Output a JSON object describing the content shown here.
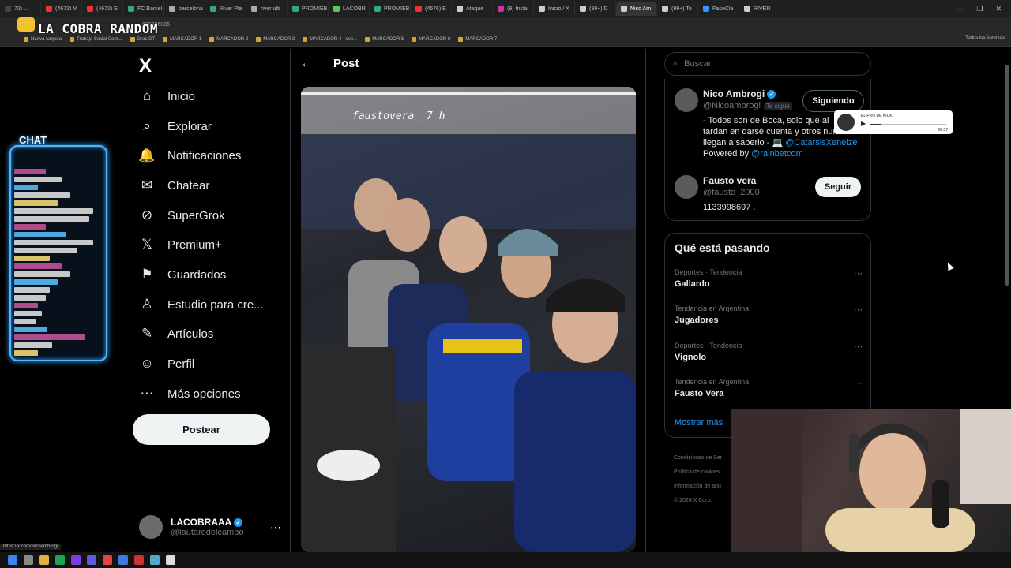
{
  "browser": {
    "tabs": [
      {
        "label": "72) ...",
        "color": "#444"
      },
      {
        "label": "(4672) M",
        "color": "#e33"
      },
      {
        "label": "(4672) E",
        "color": "#e33"
      },
      {
        "label": "FC Barcel",
        "color": "#3a7"
      },
      {
        "label": "barcelona",
        "color": "#aaa"
      },
      {
        "label": "River Pla",
        "color": "#3a7"
      },
      {
        "label": "river ulti",
        "color": "#aaa"
      },
      {
        "label": "PROMIEB",
        "color": "#3a7"
      },
      {
        "label": "LACOBR",
        "color": "#5c5"
      },
      {
        "label": "PROMIEB",
        "color": "#3a7"
      },
      {
        "label": "(4676) E",
        "color": "#e33"
      },
      {
        "label": "Ataque",
        "color": "#ccc"
      },
      {
        "label": "(9) Insta",
        "color": "#c3a"
      },
      {
        "label": "Inicio / X",
        "color": "#ccc"
      },
      {
        "label": "(99+) D",
        "color": "#ccc"
      },
      {
        "label": "Nico Am",
        "color": "#ccc"
      },
      {
        "label": "(99+) To",
        "color": "#ccc"
      },
      {
        "label": "PaseCla",
        "color": "#39f"
      },
      {
        "label": "RIVER",
        "color": "#ccc"
      }
    ],
    "active_tab": 15,
    "window_controls": [
      "—",
      "❐",
      "✕"
    ],
    "address_text": "600396085",
    "bookmarks": [
      "Nueva carpeta",
      "Trabajo Social Com...",
      "Gras DT",
      "MARCADOR 1",
      "MARCADOR 2",
      "MARCADOR 3",
      "MARCADOR 4 - ove...",
      "MARCADOR 5",
      "MARCADOR 6",
      "MARCADOR 7"
    ],
    "bookmarks_right": "Todos los favoritos",
    "status_url": "https://x.com/Nicoambrogi"
  },
  "overlay": {
    "logo_text": "LA COBRA RANDOM",
    "chat_title": "CHAT",
    "kick_title": "EL PRO DE KICK",
    "kick_time": "00:37",
    "kick_progress": 0.15
  },
  "nav": {
    "logo": "X",
    "items": [
      {
        "label": "Inicio",
        "icon": "home-icon",
        "glyph": "⌂"
      },
      {
        "label": "Explorar",
        "icon": "search-icon",
        "glyph": "⌕"
      },
      {
        "label": "Notificaciones",
        "icon": "bell-icon",
        "glyph": "🔔"
      },
      {
        "label": "Chatear",
        "icon": "mail-icon",
        "glyph": "✉"
      },
      {
        "label": "SuperGrok",
        "icon": "grok-icon",
        "glyph": "⊘"
      },
      {
        "label": "Premium+",
        "icon": "x-icon",
        "glyph": "𝕏"
      },
      {
        "label": "Guardados",
        "icon": "bookmark-icon",
        "glyph": "⚑"
      },
      {
        "label": "Estudio para cre...",
        "icon": "studio-icon",
        "glyph": "♙"
      },
      {
        "label": "Artículos",
        "icon": "article-icon",
        "glyph": "✎"
      },
      {
        "label": "Perfil",
        "icon": "person-icon",
        "glyph": "☺"
      },
      {
        "label": "Más opciones",
        "icon": "more-circle-icon",
        "glyph": "⋯"
      }
    ],
    "post_label": "Postear",
    "account": {
      "name": "LACOBRAAA",
      "handle": "@lautarodelcampo"
    }
  },
  "post": {
    "title": "Post",
    "photo_caption": "faustovera_  7 h"
  },
  "right": {
    "search_placeholder": "Buscar",
    "people": [
      {
        "name": "Nico Ambrogi",
        "handle": "@Nicoambrogi",
        "follows_you": "Te sigue",
        "button": "Siguiendo",
        "bio_1": "- Todos son de Boca, solo que al",
        "bio_2": "tardan en darse cuenta y otros nunca",
        "bio_3": "llegan a saberlo - 💻 ",
        "bio_link": "@CatarsisXeneize",
        "bio_4": "Powered by ",
        "bio_link2": "@rainbetcom"
      },
      {
        "name": "Fausto vera",
        "handle": "@fausto_2000",
        "button": "Seguir",
        "bio_1": "1133998697 ."
      }
    ],
    "trends_heading": "Qué está pasando",
    "trends": [
      {
        "context": "Deportes · Tendencia",
        "title": "Gallardo"
      },
      {
        "context": "Tendencia en Argentina",
        "title": "Jugadores"
      },
      {
        "context": "Deportes · Tendencia",
        "title": "Vignolo"
      },
      {
        "context": "Tendencia en Argentina",
        "title": "Fausto Vera"
      }
    ],
    "show_more": "Mostrar más",
    "footer": [
      "Condiciones de Ser",
      "Política de cookies",
      "Información de anu",
      "© 2026 X Corp."
    ]
  }
}
